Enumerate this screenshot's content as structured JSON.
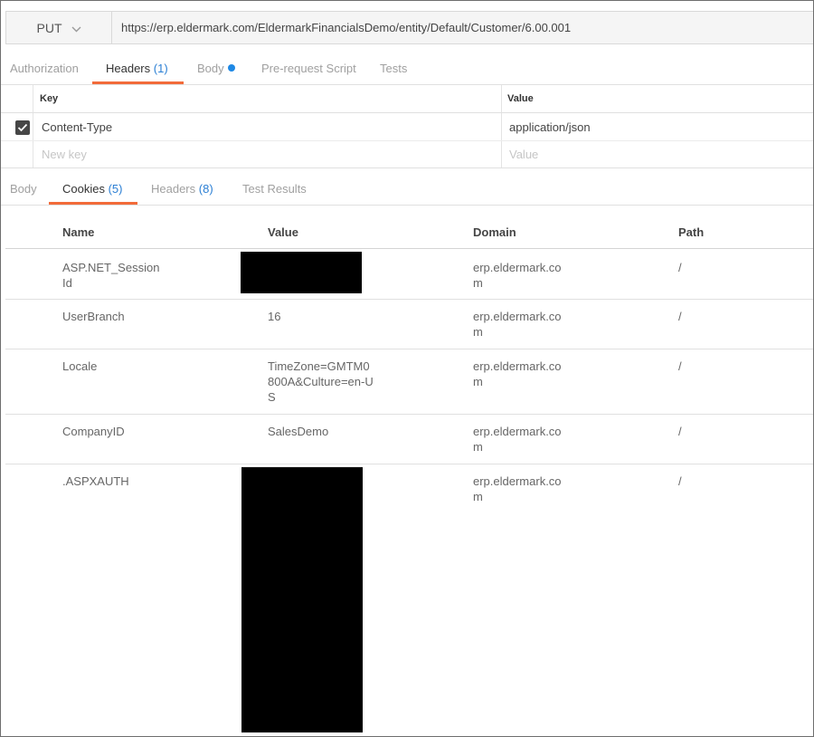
{
  "request": {
    "method": "PUT",
    "url": "https://erp.eldermark.com/EldermarkFinancialsDemo/entity/Default/Customer/6.00.001"
  },
  "request_tabs": [
    {
      "label": "Authorization",
      "count": ""
    },
    {
      "label": "Headers",
      "count": "(1)"
    },
    {
      "label": "Body",
      "count": ""
    },
    {
      "label": "Pre-request Script",
      "count": ""
    },
    {
      "label": "Tests",
      "count": ""
    }
  ],
  "headers_table": {
    "key_header": "Key",
    "value_header": "Value",
    "rows": [
      {
        "checked": true,
        "key": "Content-Type",
        "value": "application/json"
      }
    ],
    "new_key_placeholder": "New key",
    "new_value_placeholder": "Value"
  },
  "response_tabs": [
    {
      "label": "Body",
      "count": ""
    },
    {
      "label": "Cookies",
      "count": "(5)"
    },
    {
      "label": "Headers",
      "count": "(8)"
    },
    {
      "label": "Test Results",
      "count": ""
    }
  ],
  "cookies": {
    "columns": [
      "Name",
      "Value",
      "Domain",
      "Path"
    ],
    "rows": [
      {
        "name": "ASP.NET_SessionId",
        "value": "",
        "domain": "erp.eldermark.com",
        "path": "/"
      },
      {
        "name": "UserBranch",
        "value": "16",
        "domain": "erp.eldermark.com",
        "path": "/"
      },
      {
        "name": "Locale",
        "value": "TimeZone=GMTM0800A&Culture=en-US",
        "domain": "erp.eldermark.com",
        "path": "/"
      },
      {
        "name": "CompanyID",
        "value": "SalesDemo",
        "domain": "erp.eldermark.com",
        "path": "/"
      },
      {
        "name": ".ASPXAUTH",
        "value": "",
        "domain": "erp.eldermark.com",
        "path": "/"
      }
    ]
  }
}
